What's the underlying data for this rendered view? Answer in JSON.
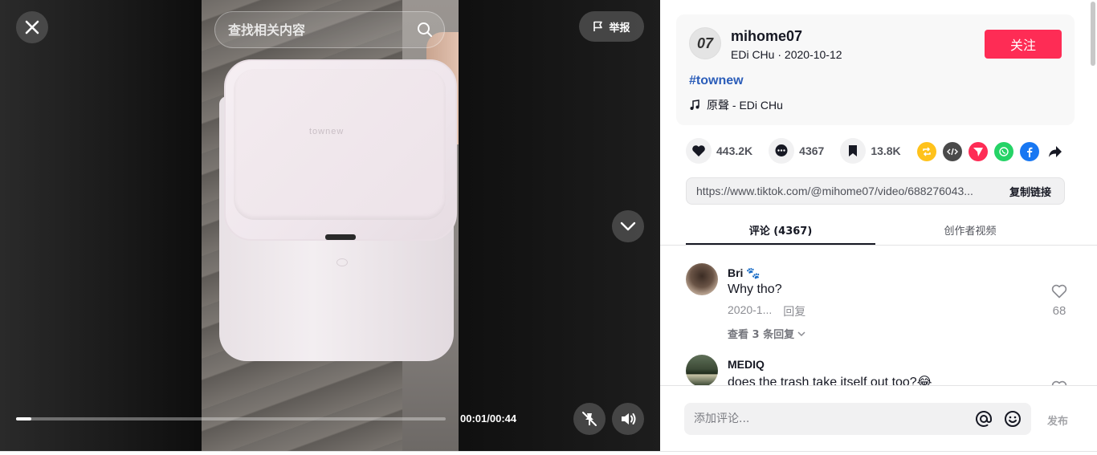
{
  "search": {
    "placeholder": "查找相关内容"
  },
  "report": {
    "label": "举报"
  },
  "video": {
    "brand_text": "townew",
    "time": "00:01/00:44",
    "progress": 0.035
  },
  "author": {
    "username": "mihome07",
    "nickname": "EDi CHu",
    "date": "2020-10-12",
    "follow_label": "关注",
    "avatar_text": "07"
  },
  "post": {
    "hashtag": "#townew",
    "music": "原聲 - EDi CHu"
  },
  "stats": {
    "likes": "443.2K",
    "comments": "4367",
    "saves": "13.8K"
  },
  "share": {
    "icons": [
      "repost-icon",
      "embed-icon",
      "send-icon",
      "whatsapp-icon",
      "facebook-icon",
      "share-more-icon"
    ],
    "colors": {
      "repost": "#ffc21b",
      "embed": "#4a4a4a",
      "send": "#fe2c55",
      "whatsapp": "#25d366",
      "facebook": "#1877f2"
    }
  },
  "link": {
    "url": "https://www.tiktok.com/@mihome07/video/688276043...",
    "copy_label": "复制链接"
  },
  "tabs": [
    {
      "label": "评论 (4367)",
      "active": true
    },
    {
      "label": "创作者视频",
      "active": false
    }
  ],
  "comments": [
    {
      "user": "Bri 🐾",
      "text": "Why tho?",
      "date": "2020-1...",
      "reply_label": "回复",
      "likes": "68",
      "view_replies": "查看 3 条回复"
    },
    {
      "user": "MEDIQ",
      "text": "does the trash take itself out too?😂"
    }
  ],
  "footer": {
    "input_placeholder": "添加评论...",
    "post_label": "发布"
  },
  "colors": {
    "accent": "#fe2c55",
    "hashtag": "#2b5db9",
    "text": "#161823"
  }
}
